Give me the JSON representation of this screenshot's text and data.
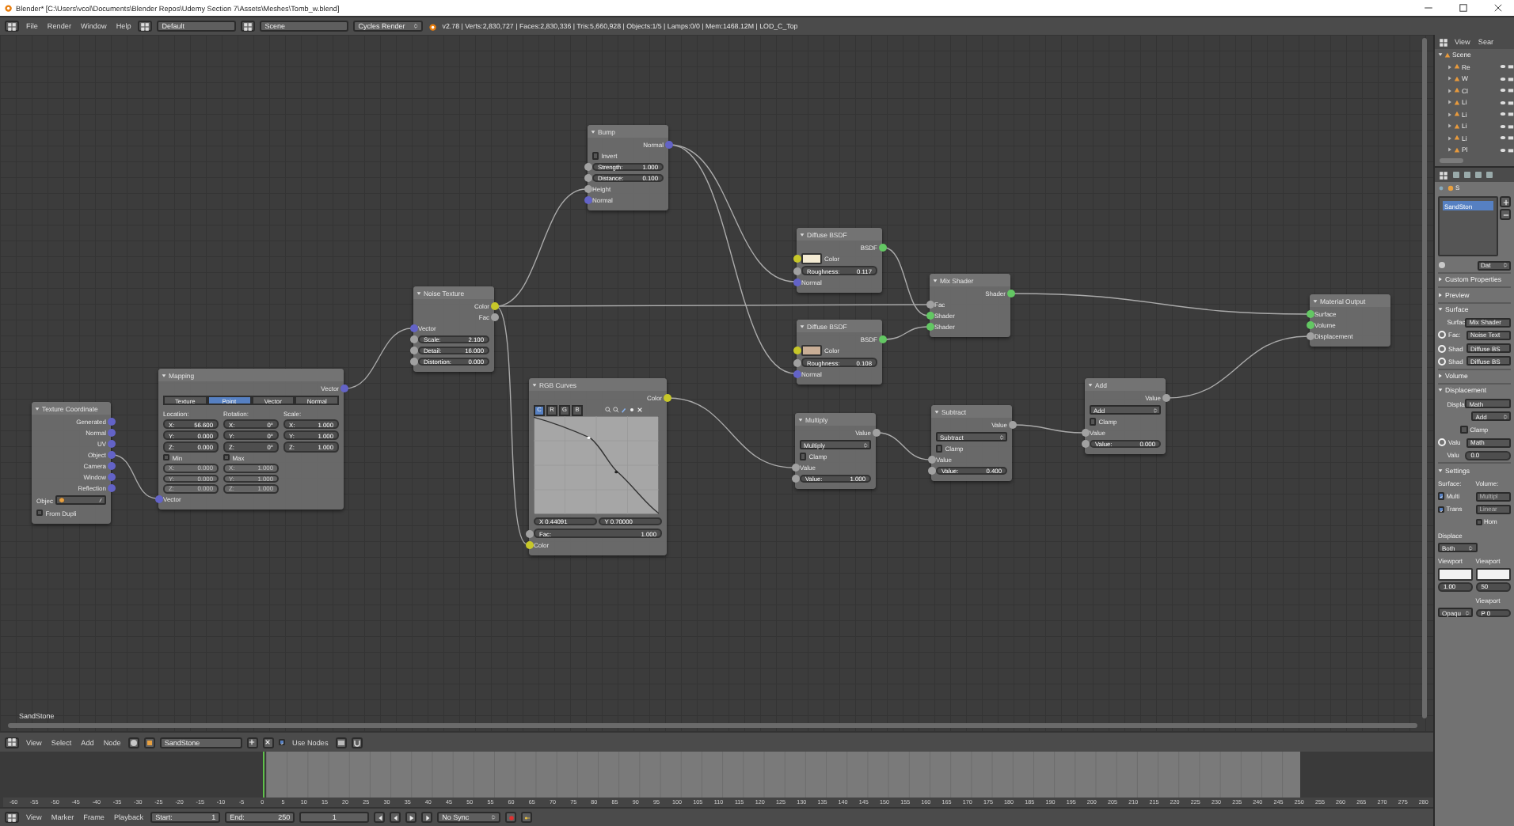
{
  "window": {
    "title": "Blender* [C:\\Users\\vcol\\Documents\\Blender Repos\\Udemy Section 7\\Assets\\Meshes\\Tomb_w.blend]"
  },
  "top_bar": {
    "menus": [
      "File",
      "Render",
      "Window",
      "Help"
    ],
    "layout": "Default",
    "scene": "Scene",
    "engine": "Cycles Render",
    "stats": "v2.78 | Verts:2,830,727 | Faces:2,830,336 | Tris:5,660,928 | Objects:1/5 | Lamps:0/0 | Mem:1468.12M | LOD_C_Top"
  },
  "node_editor": {
    "material_label": "SandStone",
    "nodes": [
      {
        "title": "Texture Coordinate",
        "rows": [
          {
            "kind": "output",
            "label": "Generated",
            "color": "#6363c7"
          },
          {
            "kind": "output",
            "label": "Normal",
            "color": "#6363c7"
          },
          {
            "kind": "output",
            "label": "UV",
            "color": "#6363c7"
          },
          {
            "kind": "output",
            "label": "Object",
            "color": "#6363c7"
          },
          {
            "kind": "output",
            "label": "Camera",
            "color": "#6363c7"
          },
          {
            "kind": "output",
            "label": "Window",
            "color": "#6363c7"
          },
          {
            "kind": "output",
            "label": "Reflection",
            "color": "#6363c7"
          },
          {
            "kind": "object",
            "label": "Objec"
          },
          {
            "kind": "checkbox",
            "label": "From Dupli",
            "checked": false
          }
        ]
      },
      {
        "title": "Mapping",
        "rows": [
          {
            "kind": "output",
            "label": "Vector",
            "color": "#6363c7"
          },
          {
            "kind": "tabs",
            "items": [
              {
                "label": "Texture",
                "selected": false
              },
              {
                "label": "Point",
                "selected": true
              },
              {
                "label": "Vector",
                "selected": false
              },
              {
                "label": "Normal",
                "selected": false
              }
            ]
          },
          {
            "kind": "columns",
            "columns": [
              {
                "label": "Location:",
                "fields": [
                  {
                    "label": "X:",
                    "value": "56.600"
                  },
                  {
                    "label": "Y:",
                    "value": "0.000"
                  },
                  {
                    "label": "Z:",
                    "value": "0.000"
                  }
                ]
              },
              {
                "label": "Rotation:",
                "fields": [
                  {
                    "label": "X:",
                    "value": "0°"
                  },
                  {
                    "label": "Y:",
                    "value": "0°"
                  },
                  {
                    "label": "Z:",
                    "value": "0°"
                  }
                ]
              },
              {
                "label": "Scale:",
                "fields": [
                  {
                    "label": "X:",
                    "value": "1.000"
                  },
                  {
                    "label": "Y:",
                    "value": "1.000"
                  },
                  {
                    "label": "Z:",
                    "value": "1.000"
                  }
                ]
              }
            ]
          },
          {
            "kind": "minmax",
            "columns": [
              {
                "label": "Min",
                "checked": false,
                "fields": [
                  {
                    "label": "X:",
                    "value": "0.000"
                  },
                  {
                    "label": "Y:",
                    "value": "0.000"
                  },
                  {
                    "label": "Z:",
                    "value": "0.000"
                  }
                ]
              },
              {
                "label": "Max",
                "checked": false,
                "fields": [
                  {
                    "label": "X:",
                    "value": "1.000"
                  },
                  {
                    "label": "Y:",
                    "value": "1.000"
                  },
                  {
                    "label": "Z:",
                    "value": "1.000"
                  }
                ]
              }
            ]
          },
          {
            "kind": "input",
            "label": "Vector",
            "color": "#6363c7"
          }
        ]
      },
      {
        "title": "Noise Texture",
        "rows": [
          {
            "kind": "output",
            "label": "Color",
            "color": "#c7c729"
          },
          {
            "kind": "output",
            "label": "Fac",
            "color": "#a1a1a1"
          },
          {
            "kind": "input",
            "label": "Vector",
            "color": "#6363c7"
          },
          {
            "kind": "field",
            "label": "Scale:",
            "value": "2.100",
            "color": "#a1a1a1"
          },
          {
            "kind": "field",
            "label": "Detail:",
            "value": "16.000",
            "color": "#a1a1a1"
          },
          {
            "kind": "field",
            "label": "Distortion:",
            "value": "0.000",
            "color": "#a1a1a1"
          }
        ]
      },
      {
        "title": "Bump",
        "rows": [
          {
            "kind": "output",
            "label": "Normal",
            "color": "#6363c7"
          },
          {
            "kind": "checkbox",
            "label": "Invert",
            "checked": false
          },
          {
            "kind": "field",
            "label": "Strength:",
            "value": "1.000",
            "color": "#a1a1a1"
          },
          {
            "kind": "field",
            "label": "Distance:",
            "value": "0.100",
            "color": "#a1a1a1"
          },
          {
            "kind": "input",
            "label": "Height",
            "color": "#a1a1a1"
          },
          {
            "kind": "input",
            "label": "Normal",
            "color": "#6363c7"
          }
        ]
      },
      {
        "title": "Diffuse BSDF",
        "rows": [
          {
            "kind": "output",
            "label": "BSDF",
            "color": "#63c763"
          },
          {
            "kind": "swatch",
            "label": "Color",
            "color": "#f4ebd3",
            "socket": {
              "color": "#c7c729"
            }
          },
          {
            "kind": "field",
            "label": "Roughness:",
            "value": "0.117",
            "color": "#a1a1a1"
          },
          {
            "kind": "input",
            "label": "Normal",
            "color": "#6363c7"
          }
        ]
      },
      {
        "title": "Diffuse BSDF",
        "rows": [
          {
            "kind": "output",
            "label": "BSDF",
            "color": "#63c763"
          },
          {
            "kind": "swatch",
            "label": "Color",
            "color": "#c9ae96",
            "socket": {
              "color": "#c7c729"
            }
          },
          {
            "kind": "field",
            "label": "Roughness:",
            "value": "0.108",
            "color": "#a1a1a1"
          },
          {
            "kind": "input",
            "label": "Normal",
            "color": "#6363c7"
          }
        ]
      },
      {
        "title": "Mix Shader",
        "rows": [
          {
            "kind": "output",
            "label": "Shader",
            "color": "#63c763"
          },
          {
            "kind": "input",
            "label": "Fac",
            "color": "#a1a1a1"
          },
          {
            "kind": "input",
            "label": "Shader",
            "color": "#63c763"
          },
          {
            "kind": "input",
            "label": "Shader",
            "color": "#63c763"
          }
        ]
      },
      {
        "title": "Material Output",
        "rows": [
          {
            "kind": "input",
            "label": "Surface",
            "color": "#63c763"
          },
          {
            "kind": "input",
            "label": "Volume",
            "color": "#63c763"
          },
          {
            "kind": "input",
            "label": "Displacement",
            "color": "#a1a1a1"
          }
        ]
      },
      {
        "title": "RGB Curves",
        "rows": [
          {
            "kind": "output",
            "label": "Color",
            "color": "#c7c729"
          },
          {
            "kind": "curve",
            "channels": [
              {
                "label": "C",
                "selected": true
              },
              {
                "label": "R",
                "selected": false
              },
              {
                "label": "G",
                "selected": false
              },
              {
                "label": "B",
                "selected": false
              }
            ]
          },
          {
            "kind": "pair",
            "items": [
              "X 0.44091",
              "Y 0.70000"
            ]
          },
          {
            "kind": "field",
            "label": "Fac:",
            "value": "1.000",
            "color": "#a1a1a1"
          },
          {
            "kind": "input",
            "label": "Color",
            "color": "#c7c729"
          }
        ]
      },
      {
        "title": "Multiply",
        "rows": [
          {
            "kind": "output",
            "label": "Value",
            "color": "#a1a1a1"
          },
          {
            "kind": "dropdown",
            "value": "Multiply"
          },
          {
            "kind": "checkbox",
            "label": "Clamp",
            "checked": false
          },
          {
            "kind": "input",
            "label": "Value",
            "color": "#a1a1a1"
          },
          {
            "kind": "field",
            "label": "Value:",
            "value": "1.000",
            "color": "#a1a1a1"
          }
        ]
      },
      {
        "title": "Subtract",
        "rows": [
          {
            "kind": "output",
            "label": "Value",
            "color": "#a1a1a1"
          },
          {
            "kind": "dropdown",
            "value": "Subtract"
          },
          {
            "kind": "checkbox",
            "label": "Clamp",
            "checked": false
          },
          {
            "kind": "input",
            "label": "Value",
            "color": "#a1a1a1"
          },
          {
            "kind": "field",
            "label": "Value:",
            "value": "0.400",
            "color": "#a1a1a1"
          }
        ]
      },
      {
        "title": "Add",
        "rows": [
          {
            "kind": "output",
            "label": "Value",
            "color": "#a1a1a1"
          },
          {
            "kind": "dropdown",
            "value": "Add"
          },
          {
            "kind": "checkbox",
            "label": "Clamp",
            "checked": false
          },
          {
            "kind": "input",
            "label": "Value",
            "color": "#a1a1a1"
          },
          {
            "kind": "field",
            "label": "Value:",
            "value": "0.000",
            "color": "#a1a1a1"
          }
        ]
      }
    ]
  },
  "node_header": {
    "menus": [
      "View",
      "Select",
      "Add",
      "Node"
    ],
    "material": "SandStone",
    "use_nodes": {
      "label": "Use Nodes",
      "checked": true
    }
  },
  "timeline": {
    "ruler": [
      "-60",
      "-55",
      "-50",
      "-45",
      "-40",
      "-35",
      "-30",
      "-25",
      "-20",
      "-15",
      "-10",
      "-5",
      "0",
      "5",
      "10",
      "15",
      "20",
      "25",
      "30",
      "35",
      "40",
      "45",
      "50",
      "55",
      "60",
      "65",
      "70",
      "75",
      "80",
      "85",
      "90",
      "95",
      "100",
      "105",
      "110",
      "115",
      "120",
      "125",
      "130",
      "135",
      "140",
      "145",
      "150",
      "155",
      "160",
      "165",
      "170",
      "175",
      "180",
      "185",
      "190",
      "195",
      "200",
      "205",
      "210",
      "215",
      "220",
      "225",
      "230",
      "235",
      "240",
      "245",
      "250",
      "255",
      "260",
      "265",
      "270",
      "275",
      "280"
    ],
    "menus": [
      "View",
      "Marker",
      "Frame",
      "Playback"
    ],
    "start_label": "Start:",
    "start": "1",
    "end_label": "End:",
    "end": "250",
    "frame": "1",
    "sync": "No Sync"
  },
  "outliner": {
    "menus": [
      "View",
      "Sear"
    ],
    "tree": [
      {
        "label": "Scene",
        "expanded": true,
        "children": [
          {
            "label": "Re"
          },
          {
            "label": "W"
          },
          {
            "label": "Cl"
          },
          {
            "label": "Li"
          },
          {
            "label": "Li"
          },
          {
            "label": "Li"
          },
          {
            "label": "Li"
          },
          {
            "label": "Pl"
          }
        ]
      }
    ]
  },
  "properties": {
    "breadcrumb": "S",
    "slots": [
      {
        "label": "SandSton",
        "selected": true
      }
    ],
    "datablock": "Dat",
    "panels": [
      {
        "title": "Custom Properties",
        "expanded": false
      },
      {
        "title": "Preview",
        "expanded": false
      },
      {
        "title": "Surface",
        "expanded": true,
        "rows": [
          {
            "kind": "prop",
            "label": "Surfac",
            "value": "Mix Shader",
            "linked": false
          },
          {
            "kind": "prop",
            "label": "Fac:",
            "value": "Noise Text",
            "linked": true
          },
          {
            "kind": "prop",
            "label": "Shad",
            "value": "Diffuse BS",
            "linked": true
          },
          {
            "kind": "prop",
            "label": "Shad",
            "value": "Diffuse BS",
            "linked": true
          }
        ]
      },
      {
        "title": "Volume",
        "expanded": false
      },
      {
        "title": "Displacement",
        "expanded": true,
        "rows": [
          {
            "kind": "prop",
            "label": "Displa",
            "value": "Math",
            "linked": false
          },
          {
            "kind": "dropdown",
            "value": "Add"
          },
          {
            "kind": "checkbox",
            "label": "Clamp",
            "checked": false
          },
          {
            "kind": "prop",
            "label": "Valu",
            "value": "Math",
            "linked": true
          },
          {
            "kind": "field",
            "label": "Valu",
            "value": "0.0"
          }
        ]
      },
      {
        "title": "Settings",
        "expanded": true,
        "rows": [
          {
            "kind": "labels",
            "items": [
              "Surface:",
              "Volume:"
            ]
          },
          {
            "kind": "check_prop",
            "label": "Multi",
            "checked": true,
            "value": "Multipl",
            "disabled": true
          },
          {
            "kind": "check_prop",
            "label": "Trans",
            "checked": true,
            "value": "Linear",
            "disabled": true
          },
          {
            "kind": "checkbox_right",
            "label": "Hom",
            "checked": false
          },
          {
            "kind": "label",
            "text": "Displace"
          },
          {
            "kind": "dropdown_left",
            "value": "Both"
          },
          {
            "kind": "labels",
            "items": [
              "Viewport",
              "Viewport"
            ]
          },
          {
            "kind": "swatches",
            "swatches": [
              {
                "color": "#f2f2f2"
              },
              {
                "color": "#f2f2f2"
              }
            ]
          },
          {
            "kind": "pair",
            "items": [
              "1.00",
              "50"
            ]
          },
          {
            "kind": "label_right",
            "text": "Viewport"
          },
          {
            "kind": "dropdown_field",
            "value": "Opaqu",
            "field": "P 0"
          }
        ]
      }
    ]
  }
}
